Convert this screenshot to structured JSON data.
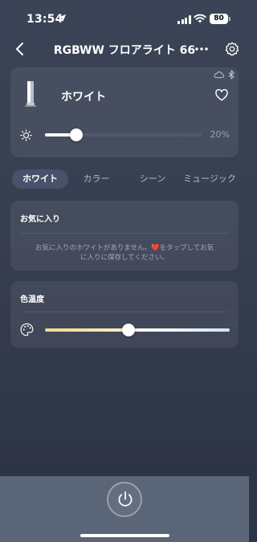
{
  "status_bar": {
    "time": "13:54",
    "battery": "80"
  },
  "nav": {
    "title": "RGBWW フロアライト 66",
    "more": "..."
  },
  "device": {
    "name": "ホワイト",
    "brightness_label": "20%",
    "brightness_fraction": 0.2
  },
  "tabs": [
    {
      "label": "ホワイト",
      "active": true
    },
    {
      "label": "カラー",
      "active": false
    },
    {
      "label": "シーン",
      "active": false
    },
    {
      "label": "ミュージック",
      "active": false
    }
  ],
  "favorites": {
    "title": "お気に入り",
    "empty_line1_a": "お気に入りのホワイトがありません。",
    "empty_heart": "❤️",
    "empty_line1_b": "をタップしてお気",
    "empty_line2": "に入りに保存してください。"
  },
  "color_temperature": {
    "title": "色温度",
    "position_fraction": 0.45
  },
  "colors": {
    "accent": "#ffffff",
    "heart": "#e8353f",
    "background_top": "#3b4456",
    "background_bottom": "#2d3446"
  }
}
